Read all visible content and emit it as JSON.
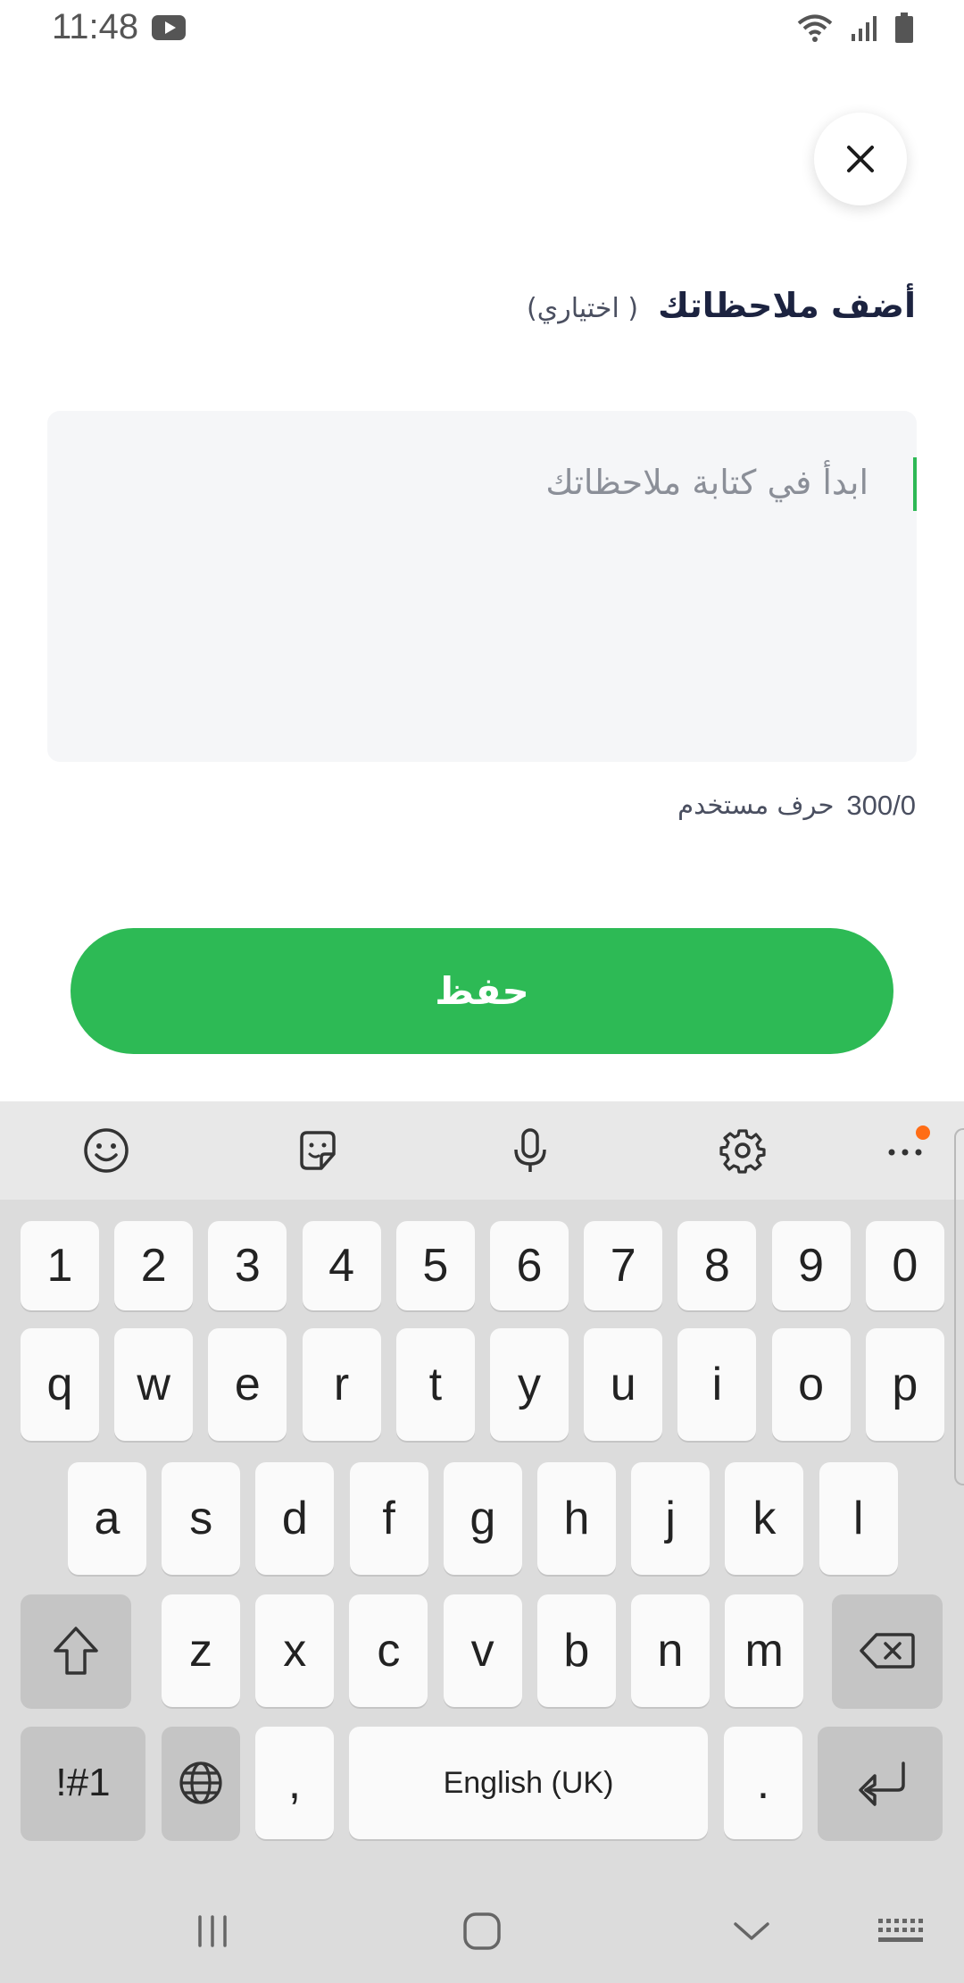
{
  "status_bar": {
    "time": "11:48"
  },
  "dialog": {
    "title": "أضف ملاحظاتك",
    "optional_label": "( اختياري)",
    "notes": {
      "value": "",
      "placeholder": "ابدأ في كتابة ملاحظاتك"
    },
    "counter": {
      "count": "300/0",
      "label": "حرف مستخدم"
    },
    "save_label": "حفظ"
  },
  "keyboard": {
    "toolbar": [
      "emoji-icon",
      "sticker-icon",
      "microphone-icon",
      "gear-icon",
      "more-icon"
    ],
    "number_row": [
      "1",
      "2",
      "3",
      "4",
      "5",
      "6",
      "7",
      "8",
      "9",
      "0"
    ],
    "row1": [
      "q",
      "w",
      "e",
      "r",
      "t",
      "y",
      "u",
      "i",
      "o",
      "p"
    ],
    "row2": [
      "a",
      "s",
      "d",
      "f",
      "g",
      "h",
      "j",
      "k",
      "l"
    ],
    "row3": [
      "z",
      "x",
      "c",
      "v",
      "b",
      "n",
      "m"
    ],
    "symbols_label": "!#1",
    "comma": ",",
    "space_label": "English (UK)",
    "period": "."
  },
  "colors": {
    "accent": "#2dba55",
    "title": "#1c2340",
    "field_bg": "#f5f6f8",
    "keyboard_bg": "#dcdcdc"
  }
}
